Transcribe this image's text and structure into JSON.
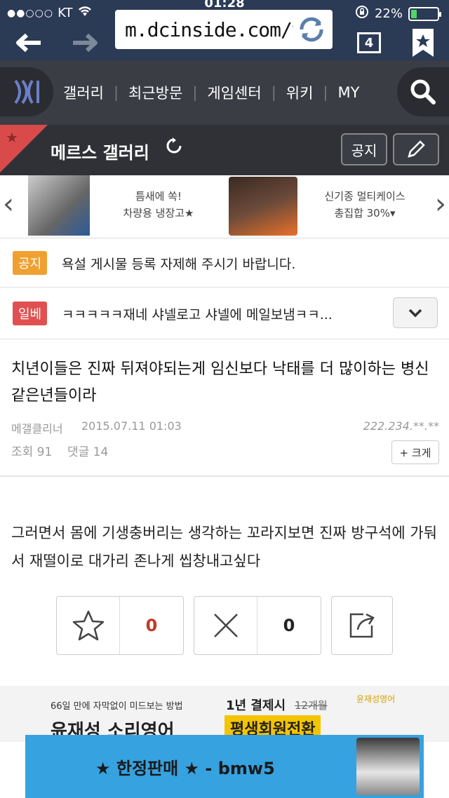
{
  "status": {
    "carrier": "KT",
    "signal_dots": "●●○○○",
    "time": "01:28",
    "battery": "22%",
    "battery_level": 0.22
  },
  "browser": {
    "url": "m.dcinside.com/v",
    "tabs_count": "4"
  },
  "nav": {
    "items": [
      "갤러리",
      "최근방문",
      "게임센터",
      "위키",
      "MY"
    ]
  },
  "gallery": {
    "title": "메르스 갤러리",
    "notice_button": "공지",
    "write_button_icon": "pencil-icon"
  },
  "ad_banner": {
    "left_line1": "틈새에 쏙!",
    "left_line2": "차량용 냉장고★",
    "right_line1": "신기종 멀티케이스",
    "right_line2": "총집합 30%▾"
  },
  "notices": [
    {
      "badge": "공지",
      "text": "욕설 게시물 등록 자제해 주시기 바랍니다.",
      "color": "#f0a030"
    },
    {
      "badge": "일베",
      "text": "ㅋㅋㅋㅋㅋ재네 샤넬로고 샤넬에 메일보냄ㅋㅋ...",
      "color": "#e05050"
    }
  ],
  "post": {
    "title": "치년이들은 진짜 뒤져야되는게 임신보다 낙태를 더 많이하는 병신같은년들이라",
    "author": "메갤클리너",
    "date": "2015.07.11 01:03",
    "ip": "222.234.**.**",
    "views": "조회 91",
    "comments": "댓글 14",
    "big_button": "+ 크게",
    "body": "그러면서 몸에 기생충버리는 생각하는 꼬라지보면 진짜 방구석에 가둬서 재떨이로 대가리 존나게 씹창내고싶다"
  },
  "votes": {
    "up": "0",
    "down": "0"
  },
  "ads": {
    "ad2_line1": "66일 만에 자막없이 미드보는 방법",
    "ad2_brand": "윤재성 소리영어",
    "ad2_right1": "1년 결제시",
    "ad2_strike": "12개월",
    "ad2_right2": "평생회원전환",
    "ad2_logo": "윤재성영어",
    "ad3_text": "★ 한정판매 ★  - bmw5"
  },
  "colors": {
    "header_bg": "#2b3a55",
    "nav_bg": "#3a3d44",
    "accent_red": "#c0392b"
  }
}
